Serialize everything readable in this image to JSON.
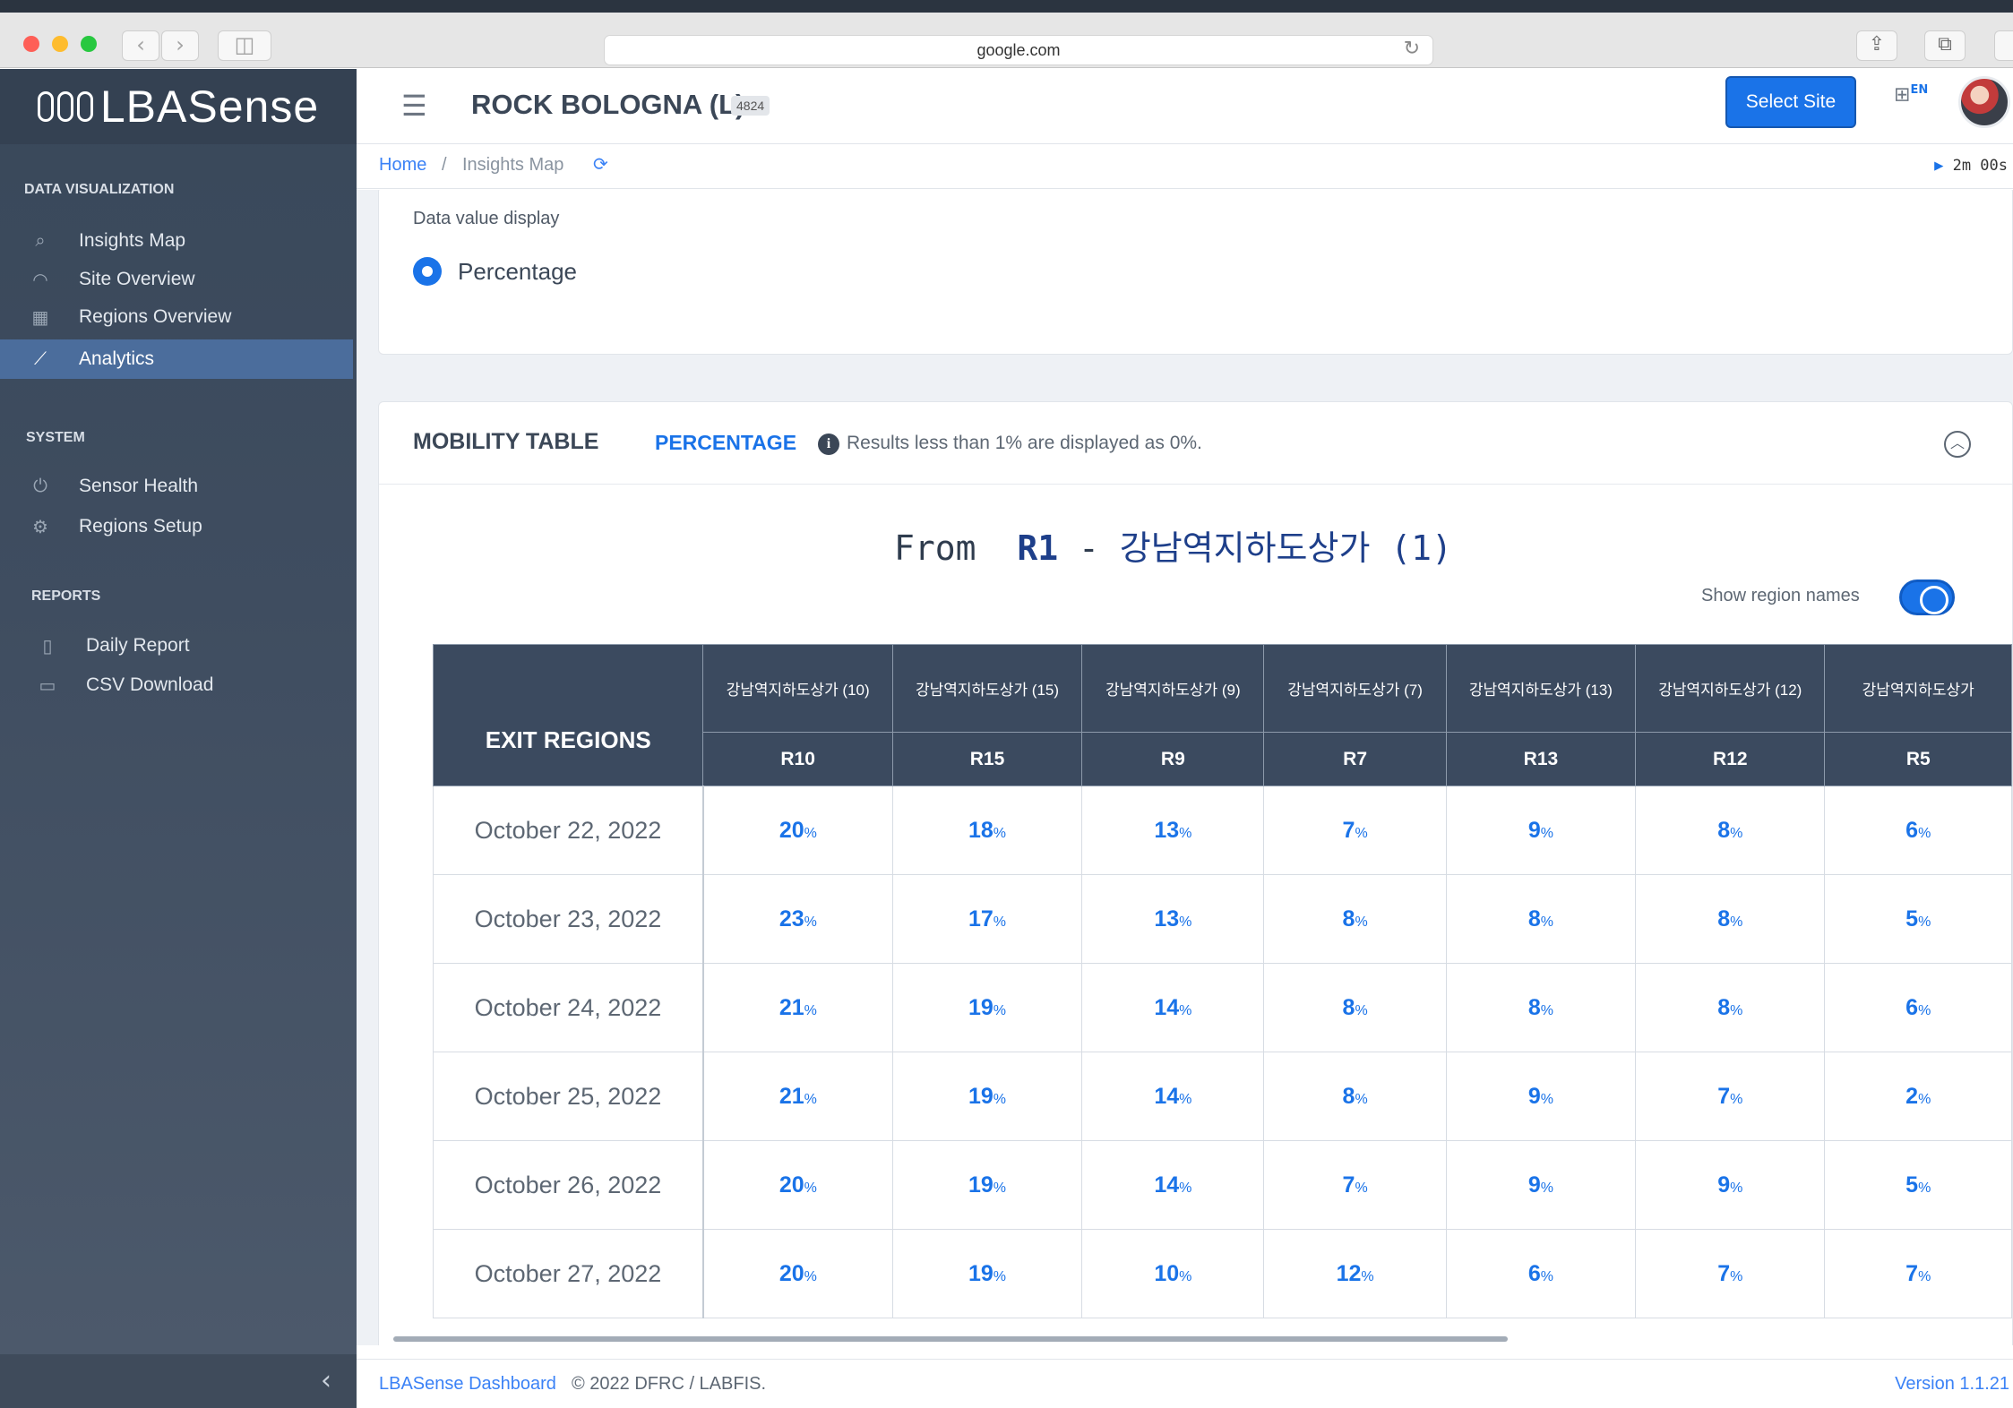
{
  "browser": {
    "url": "google.com"
  },
  "app": {
    "logo_text": "LBASense",
    "site_title": "ROCK BOLOGNA (L)",
    "site_badge": "4824",
    "select_site_label": "Select Site",
    "lang": "EN"
  },
  "sidebar": {
    "sections": [
      {
        "label": "DATA VISUALIZATION"
      },
      {
        "label": "SYSTEM"
      },
      {
        "label": "REPORTS"
      }
    ],
    "items": [
      {
        "label": "Insights Map",
        "icon": "map-search-icon",
        "active": false
      },
      {
        "label": "Site Overview",
        "icon": "gauge-icon",
        "active": false
      },
      {
        "label": "Regions Overview",
        "icon": "grid-icon",
        "active": false
      },
      {
        "label": "Analytics",
        "icon": "chart-line-icon",
        "active": true
      },
      {
        "label": "Sensor Health",
        "icon": "power-icon",
        "active": false
      },
      {
        "label": "Regions Setup",
        "icon": "gear-icon",
        "active": false
      },
      {
        "label": "Daily Report",
        "icon": "document-icon",
        "active": false
      },
      {
        "label": "CSV Download",
        "icon": "csv-icon",
        "active": false
      }
    ]
  },
  "breadcrumb": {
    "home": "Home",
    "separator": "/",
    "current": "Insights Map",
    "timer": "2m 00s"
  },
  "display": {
    "label": "Data value display",
    "option": "Percentage"
  },
  "mobility": {
    "title": "MOBILITY TABLE",
    "mode": "PERCENTAGE",
    "note": "Results less than 1% are displayed as 0%.",
    "from_prefix": "From",
    "from_region": "R1",
    "from_dash": "-",
    "from_name": "강남역지하도상가 (1)",
    "show_names_label": "Show region names",
    "exit_header": "EXIT REGIONS",
    "columns": [
      {
        "name": "강남역지하도상가 (10)",
        "code": "R10"
      },
      {
        "name": "강남역지하도상가 (15)",
        "code": "R15"
      },
      {
        "name": "강남역지하도상가 (9)",
        "code": "R9"
      },
      {
        "name": "강남역지하도상가 (7)",
        "code": "R7"
      },
      {
        "name": "강남역지하도상가 (13)",
        "code": "R13"
      },
      {
        "name": "강남역지하도상가 (12)",
        "code": "R12"
      },
      {
        "name": "강남역지하도상가",
        "code": "R5"
      }
    ],
    "pct_unit": "%",
    "rows": [
      {
        "date": "October 22, 2022",
        "values": [
          "20",
          "18",
          "13",
          "7",
          "9",
          "8",
          "6"
        ]
      },
      {
        "date": "October 23, 2022",
        "values": [
          "23",
          "17",
          "13",
          "8",
          "8",
          "8",
          "5"
        ]
      },
      {
        "date": "October 24, 2022",
        "values": [
          "21",
          "19",
          "14",
          "8",
          "8",
          "8",
          "6"
        ]
      },
      {
        "date": "October 25, 2022",
        "values": [
          "21",
          "19",
          "14",
          "8",
          "9",
          "7",
          "2"
        ]
      },
      {
        "date": "October 26, 2022",
        "values": [
          "20",
          "19",
          "14",
          "7",
          "9",
          "9",
          "5"
        ]
      },
      {
        "date": "October 27, 2022",
        "values": [
          "20",
          "19",
          "10",
          "12",
          "6",
          "7",
          "7"
        ]
      }
    ]
  },
  "footer": {
    "link": "LBASense Dashboard",
    "copyright": "© 2022 DFRC / LABFIS.",
    "version": "Version 1.1.21"
  },
  "colors": {
    "accent": "#1a73e8",
    "sidebar_bg": "#3f4d60",
    "table_header": "#3b4a5f"
  }
}
